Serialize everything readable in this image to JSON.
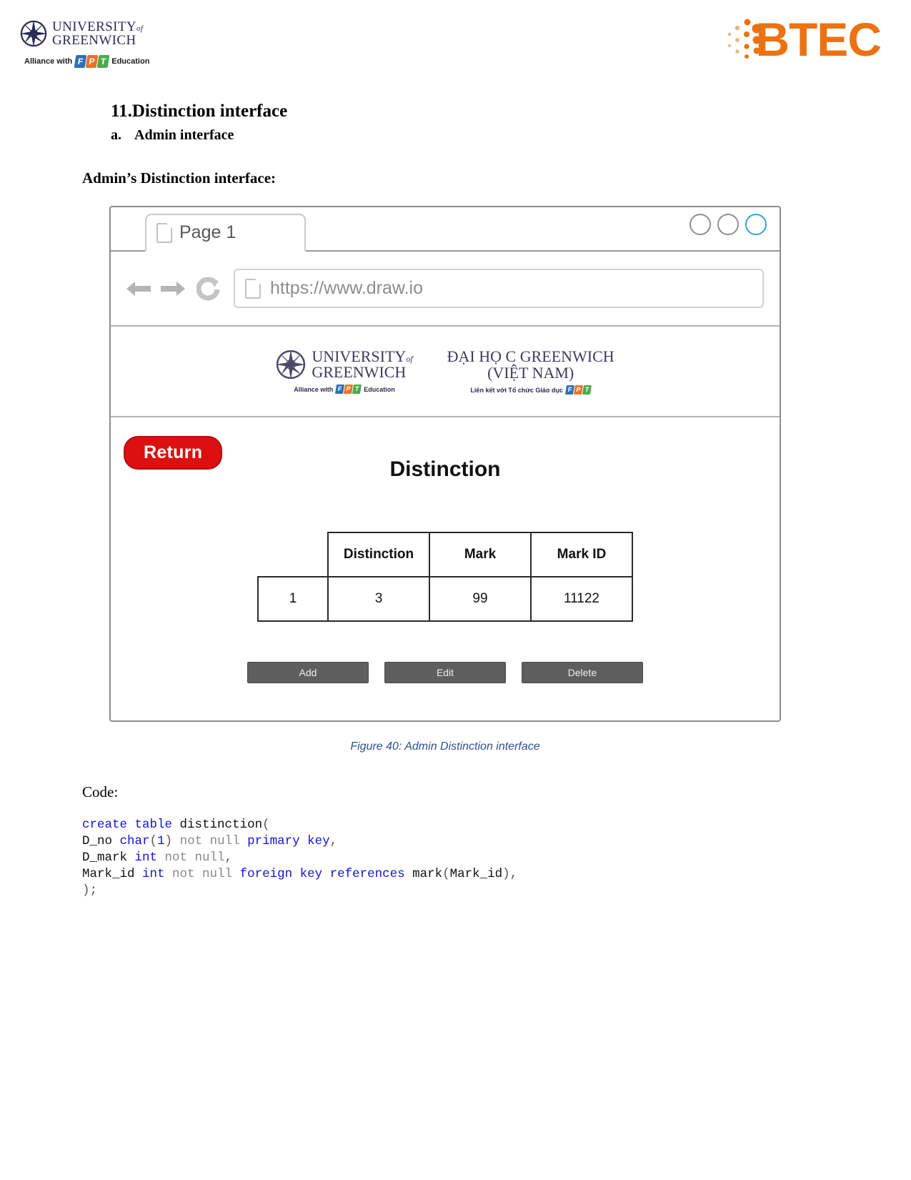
{
  "header": {
    "university_line1": "UNIVERSITY",
    "university_of": "of",
    "university_line2": "GREENWICH",
    "alliance_text": "Alliance with",
    "alliance_suffix": "Education",
    "fpt_f": "F",
    "fpt_p": "P",
    "fpt_t": "T",
    "btec_word": "BTEC",
    "btec_color": "#ec7211"
  },
  "document": {
    "section_number": "11.",
    "section_title": "Distinction interface",
    "sub_marker": "a.",
    "sub_title": "Admin interface",
    "lead_text": "Admin’s Distinction interface:",
    "figure_caption": "Figure 40: Admin Distinction interface",
    "code_label": "Code:"
  },
  "browser": {
    "tab_label": "Page 1",
    "tab_icon": "document-icon",
    "url": "https://www.draw.io",
    "url_icon": "document-icon",
    "back_icon": "arrow-left-icon",
    "forward_icon": "arrow-right-icon",
    "reload_icon": "reload-icon",
    "window_controls": [
      "minimize-circle",
      "maximize-circle",
      "close-circle"
    ],
    "active_control_color": "#3aa0dd"
  },
  "site_header": {
    "uog_line1": "UNIVERSITY",
    "uog_of": "of",
    "uog_line2": "GREENWICH",
    "uog_tagline_prefix": "Alliance with",
    "uog_tagline_suffix": "Education",
    "vn_line1": "ĐẠI HỌ C GREENWICH",
    "vn_line2": "(VIỆT NAM)",
    "vn_tagline": "Liên kết với Tổ chức Giáo dục"
  },
  "app": {
    "return_button": "Return",
    "title": "Distinction",
    "table": {
      "columns": [
        "",
        "Distinction",
        "Mark",
        "Mark ID"
      ],
      "rows": [
        [
          "1",
          "3",
          "99",
          "11122"
        ]
      ]
    },
    "buttons": [
      "Add",
      "Edit",
      "Delete"
    ],
    "return_button_color": "#dd1010"
  },
  "code": {
    "lines": [
      [
        {
          "t": "create",
          "c": "kw"
        },
        {
          "t": " ",
          "c": ""
        },
        {
          "t": "table",
          "c": "kw"
        },
        {
          "t": " distinction",
          "c": ""
        },
        {
          "t": "(",
          "c": "pun"
        }
      ],
      [
        {
          "t": "D_no ",
          "c": ""
        },
        {
          "t": "char",
          "c": "kw"
        },
        {
          "t": "(",
          "c": "pun"
        },
        {
          "t": "1",
          "c": "num"
        },
        {
          "t": ")",
          "c": "pun"
        },
        {
          "t": " ",
          "c": ""
        },
        {
          "t": "not null",
          "c": "dim"
        },
        {
          "t": " ",
          "c": ""
        },
        {
          "t": "primary key",
          "c": "kw"
        },
        {
          "t": ",",
          "c": "pun"
        }
      ],
      [
        {
          "t": "D_mark ",
          "c": ""
        },
        {
          "t": "int",
          "c": "kw"
        },
        {
          "t": " ",
          "c": ""
        },
        {
          "t": "not null",
          "c": "dim"
        },
        {
          "t": ",",
          "c": "pun"
        }
      ],
      [
        {
          "t": "Mark_id ",
          "c": ""
        },
        {
          "t": "int",
          "c": "kw"
        },
        {
          "t": " ",
          "c": ""
        },
        {
          "t": "not null",
          "c": "dim"
        },
        {
          "t": " ",
          "c": ""
        },
        {
          "t": "foreign key references",
          "c": "kw"
        },
        {
          "t": " mark",
          "c": ""
        },
        {
          "t": "(",
          "c": "pun"
        },
        {
          "t": "Mark_id",
          "c": ""
        },
        {
          "t": ")",
          "c": "pun"
        },
        {
          "t": ",",
          "c": "pun"
        }
      ],
      [
        {
          "t": ")",
          "c": "pun"
        },
        {
          "t": ";",
          "c": "pun"
        }
      ]
    ]
  }
}
